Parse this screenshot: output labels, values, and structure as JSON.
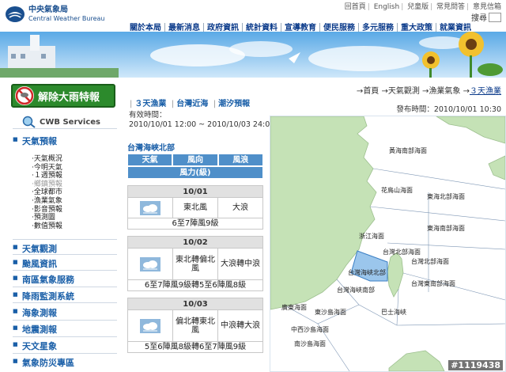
{
  "header": {
    "logo_zh": "中央氣象局",
    "logo_en": "Central Weather Bureau",
    "top_links": [
      "回首頁",
      "English",
      "兒童版",
      "常見問答",
      "意見信箱"
    ],
    "search_label": "搜尋"
  },
  "nav": [
    "關於本局",
    "最新消息",
    "政府資訊",
    "統計資料",
    "宣導教育",
    "便民服務",
    "多元服務",
    "重大政策",
    "就業資訊"
  ],
  "sidebar": {
    "alert_label": "解除大雨特報",
    "services_label": "CWB Services",
    "sections": [
      {
        "label": "天氣預報",
        "items": [
          "天氣概況",
          "今明天氣",
          "１週預報",
          "鄉鎮預報",
          "全球都市",
          "漁業氣象",
          "影音預報",
          "預測圖",
          "數值預報"
        ]
      },
      {
        "label": "天氣觀測"
      },
      {
        "label": "颱風資訊"
      },
      {
        "label": "南區氣象服務"
      },
      {
        "label": "降雨監測系統"
      },
      {
        "label": "海象測報"
      },
      {
        "label": "地震測報"
      },
      {
        "label": "天文星象"
      },
      {
        "label": "氣象防災專區"
      }
    ]
  },
  "breadcrumb": [
    "首頁",
    "天氣觀測",
    "漁業氣象",
    "３天漁業"
  ],
  "publish_time": "發布時間：2010/10/01 10:30",
  "subtabs": [
    "３天漁業",
    "台灣近海",
    "潮汐預報"
  ],
  "valid_label": "有效時間：",
  "valid_range": "2010/10/01 12:00 ~ 2010/10/03 24:00",
  "region_title": "台灣海峽北部",
  "table_headers": {
    "sky": "天氣",
    "wind_dir": "風向",
    "wave": "風浪",
    "wind_level": "風力(級)"
  },
  "forecast": [
    {
      "date": "10/01",
      "wind_dir": "東北風",
      "wave": "大浪",
      "wind_level": "6至7陣風9級"
    },
    {
      "date": "10/02",
      "wind_dir": "東北轉偏北風",
      "wave": "大浪轉中浪",
      "wind_level": "6至7陣風9級轉5至6陣風8級"
    },
    {
      "date": "10/03",
      "wind_dir": "偏北轉東北風",
      "wave": "中浪轉大浪",
      "wind_level": "5至6陣風8級轉6至7陣風9級"
    }
  ],
  "map_labels": [
    "黃海南部海面",
    "花鳥山海面",
    "東海北部海面",
    "東海南部海面",
    "浙江海面",
    "台灣北部海面",
    "台灣海峽北部",
    "台灣北部海面",
    "台灣東南部海面",
    "台灣海峽南部",
    "廣東海面",
    "東沙島海面",
    "巴士海峽",
    "中西沙島海面",
    "南沙島海面"
  ],
  "watermark": "#1119438",
  "colors": {
    "nav_text": "#0a3a8a",
    "table_header": "#4f8fc9",
    "alert_green": "#2c8a2c",
    "sea": "#ffffff",
    "land": "#c5e2b6",
    "highlight_region": "#9bc6ec"
  }
}
